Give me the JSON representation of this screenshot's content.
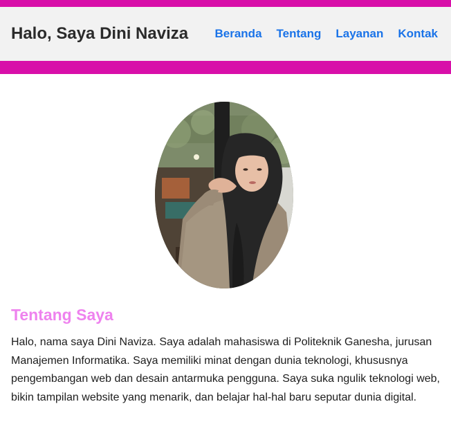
{
  "header": {
    "title": "Halo, Saya Dini Naviza",
    "nav": [
      "Beranda",
      "Tentang",
      "Layanan",
      "Kontak"
    ]
  },
  "profile": {
    "photo_alt": "Dini Naviza"
  },
  "about": {
    "heading": "Tentang Saya",
    "text": "Halo, nama saya Dini Naviza. Saya adalah mahasiswa di Politeknik Ganesha, jurusan Manajemen Informatika. Saya memiliki minat dengan dunia teknologi, khususnya pengembangan web dan desain antarmuka pengguna. Saya suka ngulik teknologi web, bikin tampilan website yang menarik, dan belajar hal-hal baru seputar dunia digital."
  },
  "colors": {
    "accent_stripe": "#d80fa9",
    "header_bg": "#f2f2f2",
    "nav_link": "#1a73e8",
    "heading": "#ee82ee"
  }
}
